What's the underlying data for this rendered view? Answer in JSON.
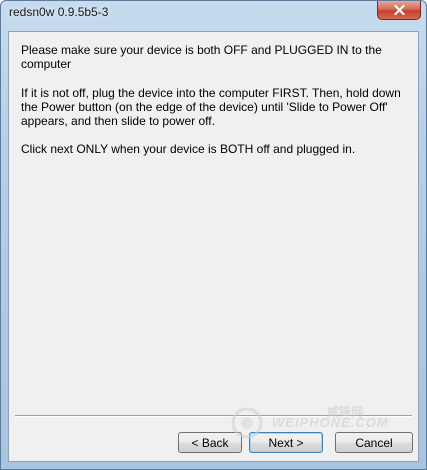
{
  "window": {
    "title": "redsn0w 0.9.5b5-3"
  },
  "message": {
    "line1": "Please make sure your device is both OFF and PLUGGED IN to the computer",
    "line2": "If it is not off, plug the device into the computer FIRST. Then, hold down the Power button (on the edge of the device) until 'Slide to Power Off' appears, and then slide to power off.",
    "line3": "Click next ONLY when your device is BOTH off and plugged in."
  },
  "buttons": {
    "back": "< Back",
    "next": "Next >",
    "cancel": "Cancel"
  },
  "watermark": {
    "cn_text": "威锋网",
    "en_text": "WEIPHONE.COM"
  },
  "colors": {
    "titlebar": "#b7cfe7",
    "close_button": "#c2412f",
    "client_bg": "#f0f0f0"
  },
  "icons": {
    "close": "close-icon"
  }
}
